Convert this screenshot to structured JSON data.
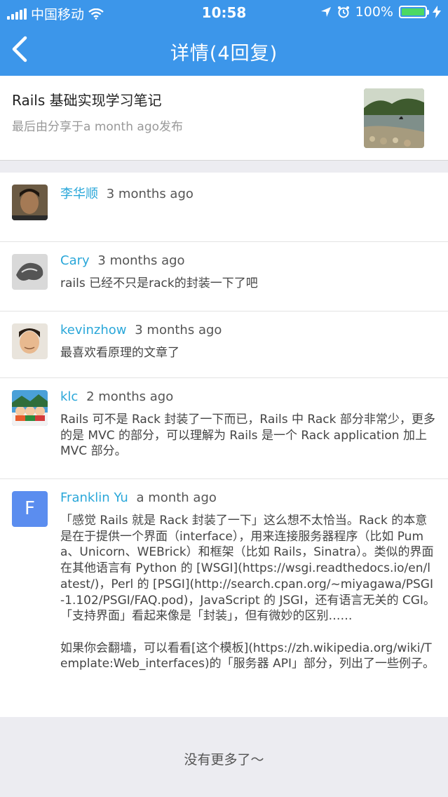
{
  "status_bar": {
    "carrier": "中国移动",
    "time": "10:58",
    "battery_pct": "100%",
    "accent_battery": "#4cd964"
  },
  "nav": {
    "title": "详情(4回复)",
    "background": "#3c96ea"
  },
  "topic": {
    "title": "Rails 基础实现学习笔记",
    "meta": "最后由分享于a month ago发布"
  },
  "replies": [
    {
      "name": "李华顺",
      "time": "3 months ago",
      "body": ""
    },
    {
      "name": "Cary",
      "time": "3 months ago",
      "body": "rails 已经不只是rack的封装一下了吧"
    },
    {
      "name": "kevinzhow",
      "time": "3 months ago",
      "body": "最喜欢看原理的文章了"
    },
    {
      "name": "klc",
      "time": "2 months ago",
      "body": "Rails 可不是 Rack 封装了一下而已，Rails 中 Rack 部分非常少，更多的是 MVC 的部分，可以理解为 Rails 是一个 Rack application 加上MVC 部分。"
    },
    {
      "name": "Franklin Yu",
      "time": "a month ago",
      "avatar_letter": "F",
      "body": "「感觉 Rails 就是 Rack 封装了一下」这么想不太恰当。Rack 的本意是在于提供一个界面（interface），用来连接服务器程序（比如 Puma、Unicorn、WEBrick）和框架（比如 Rails，Sinatra）。类似的界面在其他语言有 Python 的 [WSGI](https://wsgi.readthedocs.io/en/latest/)，Perl 的 [PSGI](http://search.cpan.org/~miyagawa/PSGI-1.102/PSGI/FAQ.pod)，JavaScript 的 JSGI，还有语言无关的 CGI。「支持界面」看起来像是「封装」，但有微妙的区别……\n\n如果你会翻墙，可以看看[这个模板](https://zh.wikipedia.org/wiki/Template:Web_interfaces)的「服务器 API」部分，列出了一些例子。"
    }
  ],
  "footer": "没有更多了～",
  "colors": {
    "link": "#2aa7d9",
    "page_bg": "#ececf1"
  }
}
